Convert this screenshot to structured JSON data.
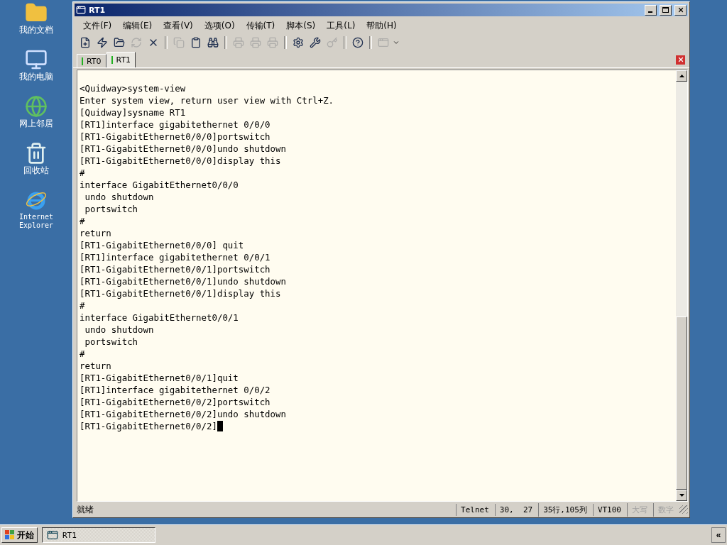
{
  "desktop_icons": [
    {
      "kind": "documents",
      "label": "我的文档"
    },
    {
      "kind": "computer",
      "label": "我的电脑"
    },
    {
      "kind": "network",
      "label": "网上邻居"
    },
    {
      "kind": "recycle",
      "label": "回收站"
    },
    {
      "kind": "browser",
      "label": "Internet Explorer"
    }
  ],
  "window": {
    "title": "RT1"
  },
  "menu": [
    "文件(F)",
    "编辑(E)",
    "查看(V)",
    "选项(O)",
    "传输(T)",
    "脚本(S)",
    "工具(L)",
    "帮助(H)"
  ],
  "toolbar": [
    {
      "kind": "connect",
      "disabled": false
    },
    {
      "kind": "quick-connect",
      "disabled": false
    },
    {
      "kind": "folder",
      "disabled": false
    },
    {
      "kind": "reconnect",
      "disabled": true
    },
    {
      "kind": "disconnect",
      "disabled": false
    },
    {
      "kind": "separator"
    },
    {
      "kind": "copy",
      "disabled": true
    },
    {
      "kind": "paste",
      "disabled": false
    },
    {
      "kind": "find",
      "disabled": false
    },
    {
      "kind": "separator"
    },
    {
      "kind": "print",
      "disabled": true
    },
    {
      "kind": "print",
      "disabled": true
    },
    {
      "kind": "print",
      "disabled": true
    },
    {
      "kind": "separator"
    },
    {
      "kind": "options",
      "disabled": false
    },
    {
      "kind": "tools",
      "disabled": false
    },
    {
      "kind": "key",
      "disabled": true
    },
    {
      "kind": "separator"
    },
    {
      "kind": "help",
      "disabled": false
    },
    {
      "kind": "separator"
    },
    {
      "kind": "window",
      "disabled": true
    }
  ],
  "tabs": [
    {
      "label": "RT0",
      "selected": false
    },
    {
      "label": "RT1",
      "selected": true
    }
  ],
  "terminal": {
    "cursor_visible": true,
    "lines": [
      "<Quidway>system-view",
      "Enter system view, return user view with Ctrl+Z.",
      "[Quidway]sysname RT1",
      "[RT1]interface gigabitethernet 0/0/0",
      "[RT1-GigabitEthernet0/0/0]portswitch",
      "[RT1-GigabitEthernet0/0/0]undo shutdown",
      "[RT1-GigabitEthernet0/0/0]display this",
      "#",
      "interface GigabitEthernet0/0/0",
      " undo shutdown",
      " portswitch",
      "#",
      "return",
      "[RT1-GigabitEthernet0/0/0] quit",
      "[RT1]interface gigabitethernet 0/0/1",
      "[RT1-GigabitEthernet0/0/1]portswitch",
      "[RT1-GigabitEthernet0/0/1]undo shutdown",
      "[RT1-GigabitEthernet0/0/1]display this",
      "#",
      "interface GigabitEthernet0/0/1",
      " undo shutdown",
      " portswitch",
      "#",
      "return",
      "[RT1-GigabitEthernet0/0/1]quit",
      "[RT1]interface gigabitethernet 0/0/2",
      "[RT1-GigabitEthernet0/0/2]portswitch",
      "[RT1-GigabitEthernet0/0/2]undo shutdown",
      "[RT1-GigabitEthernet0/0/2]"
    ]
  },
  "status_bar": {
    "message": "就绪",
    "panes": [
      {
        "text": "Telnet",
        "disabled": false
      },
      {
        "text": "30,  27",
        "disabled": false
      },
      {
        "text": "35行,105列",
        "disabled": false
      },
      {
        "text": "VT100",
        "disabled": false
      },
      {
        "text": "大写",
        "disabled": true
      },
      {
        "text": "数字",
        "disabled": true
      }
    ]
  },
  "taskbar": {
    "start": "开始",
    "tasks": [
      {
        "label": "RT1",
        "selected": true
      }
    ],
    "tray_button": "«"
  }
}
